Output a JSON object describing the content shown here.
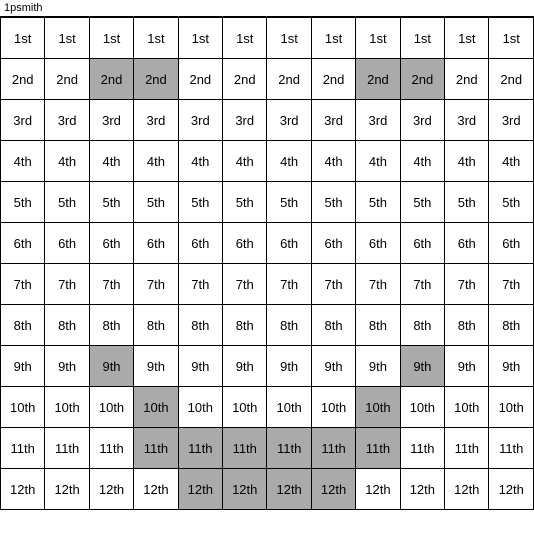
{
  "title": "1psmith",
  "rows": [
    {
      "label": "1st",
      "highlights": [
        false,
        false,
        false,
        false,
        false,
        false,
        false,
        false,
        false,
        false,
        false,
        false
      ]
    },
    {
      "label": "2nd",
      "highlights": [
        false,
        false,
        true,
        true,
        false,
        false,
        false,
        false,
        true,
        true,
        false,
        false
      ]
    },
    {
      "label": "3rd",
      "highlights": [
        false,
        false,
        false,
        false,
        false,
        false,
        false,
        false,
        false,
        false,
        false,
        false
      ]
    },
    {
      "label": "4th",
      "highlights": [
        false,
        false,
        false,
        false,
        false,
        false,
        false,
        false,
        false,
        false,
        false,
        false
      ]
    },
    {
      "label": "5th",
      "highlights": [
        false,
        false,
        false,
        false,
        false,
        false,
        false,
        false,
        false,
        false,
        false,
        false
      ]
    },
    {
      "label": "6th",
      "highlights": [
        false,
        false,
        false,
        false,
        false,
        false,
        false,
        false,
        false,
        false,
        false,
        false
      ]
    },
    {
      "label": "7th",
      "highlights": [
        false,
        false,
        false,
        false,
        false,
        false,
        false,
        false,
        false,
        false,
        false,
        false
      ]
    },
    {
      "label": "8th",
      "highlights": [
        false,
        false,
        false,
        false,
        false,
        false,
        false,
        false,
        false,
        false,
        false,
        false
      ]
    },
    {
      "label": "9th",
      "highlights": [
        false,
        false,
        true,
        false,
        false,
        false,
        false,
        false,
        false,
        true,
        false,
        false
      ]
    },
    {
      "label": "10th",
      "highlights": [
        false,
        false,
        false,
        true,
        false,
        false,
        false,
        false,
        true,
        false,
        false,
        false
      ]
    },
    {
      "label": "11th",
      "highlights": [
        false,
        false,
        false,
        true,
        true,
        true,
        true,
        true,
        true,
        false,
        false,
        false
      ]
    },
    {
      "label": "12th",
      "highlights": [
        false,
        false,
        false,
        false,
        true,
        true,
        true,
        true,
        false,
        false,
        false,
        false
      ]
    }
  ]
}
